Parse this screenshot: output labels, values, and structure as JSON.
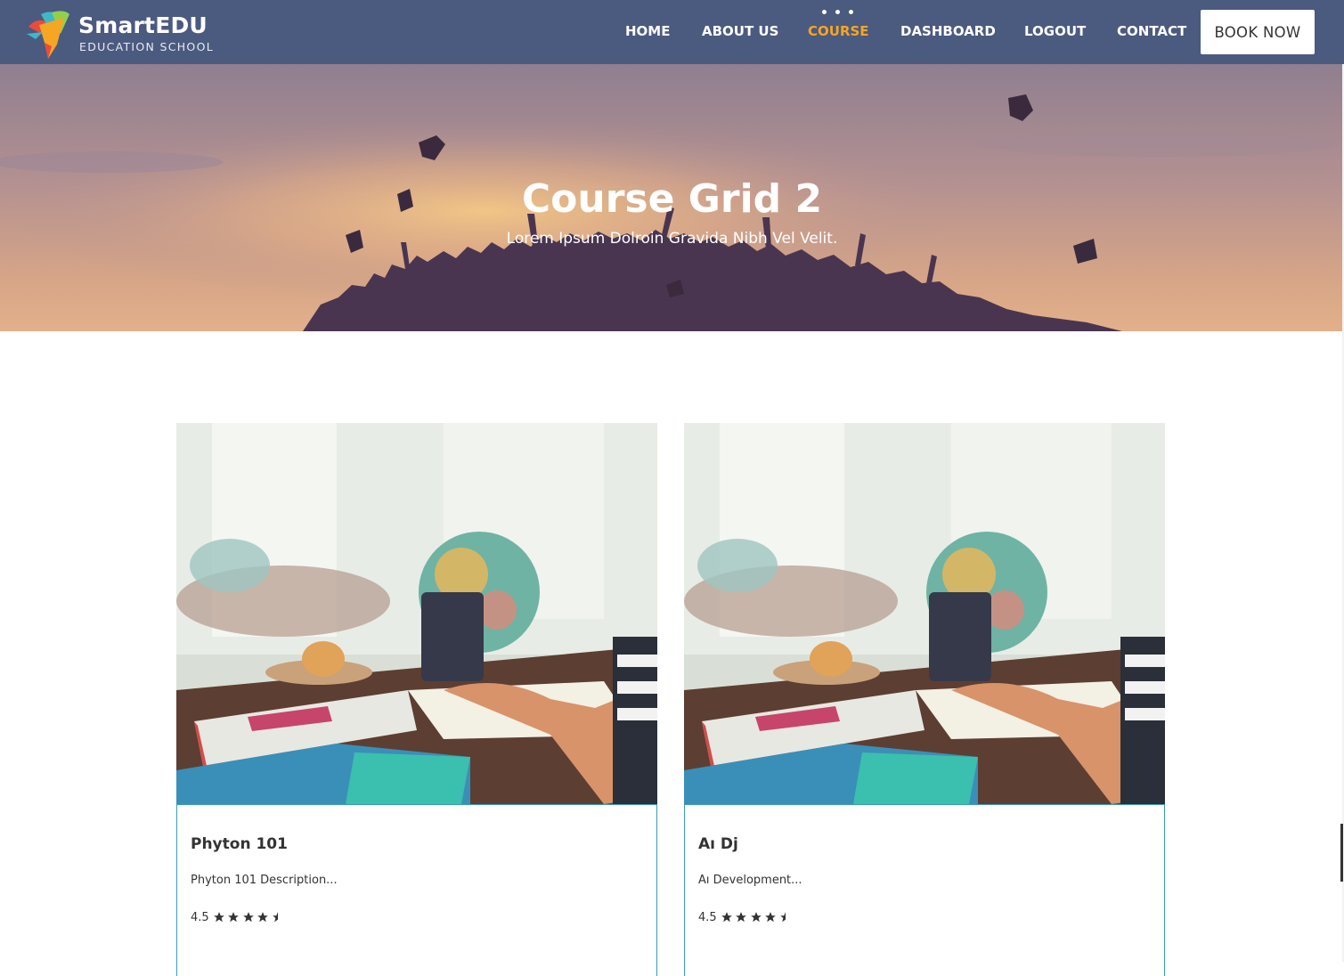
{
  "brand": {
    "title": "SmartEDU",
    "subtitle": "EDUCATION SCHOOL"
  },
  "nav": {
    "items": [
      {
        "label": "HOME"
      },
      {
        "label": "ABOUT US"
      },
      {
        "label": "COURSE",
        "active": true
      },
      {
        "label": "DASHBOARD"
      },
      {
        "label": "LOGOUT"
      },
      {
        "label": "CONTACT"
      }
    ],
    "book_label": "BOOK NOW"
  },
  "hero": {
    "title": "Course Grid 2",
    "subtitle": "Lorem Ipsum Dolroin Gravida Nibh Vel Velit."
  },
  "courses": [
    {
      "title": "Phyton 101",
      "description": "Phyton 101 Description...",
      "rating": "4.5",
      "stars": 4.5
    },
    {
      "title": "Aı Dj",
      "description": "Aı Development...",
      "rating": "4.5",
      "stars": 4.5
    }
  ],
  "colors": {
    "navbar": "#4b5a7f",
    "accent": "#f5a623",
    "card_border": "#3a9db2"
  }
}
